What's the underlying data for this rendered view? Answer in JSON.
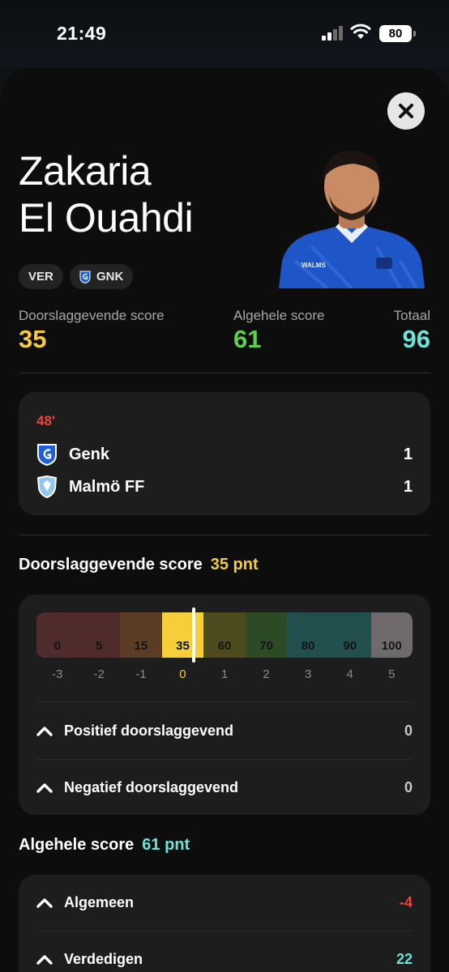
{
  "status_bar": {
    "time": "21:49",
    "battery": "80"
  },
  "player": {
    "first_name": "Zakaria",
    "last_name": "El Ouahdi"
  },
  "chips": [
    {
      "label": "VER"
    },
    {
      "label": "GNK",
      "icon": "genk-crest-icon"
    }
  ],
  "scores": {
    "decisive": {
      "label": "Doorslaggevende score",
      "value": "35",
      "color": "#f2cc45"
    },
    "overall": {
      "label": "Algehele score",
      "value": "61",
      "color": "#5fcf52"
    },
    "total": {
      "label": "Totaal",
      "value": "96",
      "color": "#6fe3d8"
    }
  },
  "match": {
    "minute": "48'",
    "teams": [
      {
        "name": "Genk",
        "score": "1",
        "icon": "genk-crest-icon"
      },
      {
        "name": "Malmö FF",
        "score": "1",
        "icon": "malmo-crest-icon"
      }
    ]
  },
  "decisive_section": {
    "title": "Doorslaggevende score",
    "points": "35 pnt",
    "points_color": "#f2cc45",
    "scale_labels": [
      "0",
      "5",
      "15",
      "35",
      "60",
      "70",
      "80",
      "90",
      "100"
    ],
    "scale_colors": [
      "#4f2b2b",
      "#4f2b2b",
      "#5b3d25",
      "#f4cf3a",
      "#4d4a1d",
      "#2b4a25",
      "#22504f",
      "#22504f",
      "#6e6a6e"
    ],
    "active_index": 3,
    "ticks": [
      "-3",
      "-2",
      "-1",
      "0",
      "1",
      "2",
      "3",
      "4",
      "5"
    ],
    "active_tick": 3,
    "rows": [
      {
        "label": "Positief doorslaggevend",
        "value": "0"
      },
      {
        "label": "Negatief doorslaggevend",
        "value": "0"
      }
    ]
  },
  "overall_section": {
    "title": "Algehele score",
    "points": "61 pnt",
    "points_color": "#6fe3d8",
    "rows": [
      {
        "label": "Algemeen",
        "value": "-4",
        "color": "#ef4438"
      },
      {
        "label": "Verdedigen",
        "value": "22",
        "color": "#6fe3d8"
      }
    ]
  }
}
